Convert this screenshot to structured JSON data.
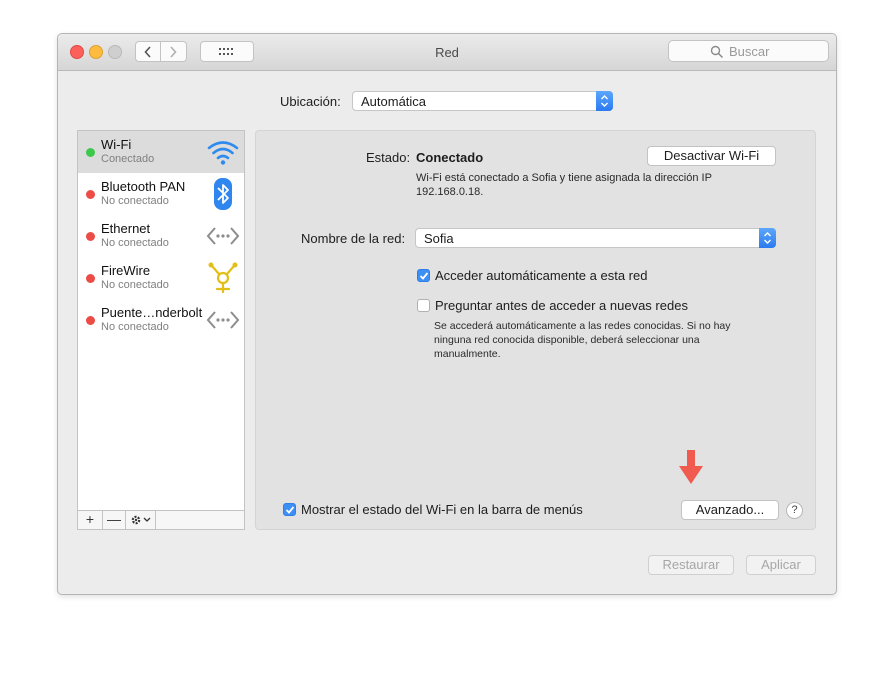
{
  "window": {
    "title": "Red",
    "search_placeholder": "Buscar"
  },
  "location": {
    "label": "Ubicación:",
    "value": "Automática"
  },
  "services": [
    {
      "name": "Wi-Fi",
      "status": "Conectado",
      "state": "green",
      "icon": "wifi-icon",
      "selected": true
    },
    {
      "name": "Bluetooth PAN",
      "status": "No conectado",
      "state": "red",
      "icon": "bluetooth-icon"
    },
    {
      "name": "Ethernet",
      "status": "No conectado",
      "state": "red",
      "icon": "ethernet-icon"
    },
    {
      "name": "FireWire",
      "status": "No conectado",
      "state": "red",
      "icon": "firewire-icon"
    },
    {
      "name": "Puente…nderbolt",
      "status": "No conectado",
      "state": "red",
      "icon": "thunderbolt-bridge-icon"
    }
  ],
  "sidebar_controls": {
    "add": "+",
    "remove": "—"
  },
  "detail": {
    "status_label": "Estado:",
    "status_value": "Conectado",
    "toggle_button": "Desactivar Wi-Fi",
    "status_description": "Wi-Fi está conectado a Sofia y tiene asignada la dirección IP 192.168.0.18.",
    "network_label": "Nombre de la red:",
    "network_value": "Sofia",
    "auto_join_label": "Acceder automáticamente a esta red",
    "auto_join_checked": true,
    "ask_join_label": "Preguntar antes de acceder a nuevas redes",
    "ask_join_checked": false,
    "ask_join_help": "Se accederá automáticamente a las redes conocidas. Si no hay ninguna red conocida disponible, deberá seleccionar una manualmente.",
    "show_status_label": "Mostrar el estado del Wi-Fi en la barra de menús",
    "show_status_checked": true,
    "advanced_button": "Avanzado...",
    "help_button": "?"
  },
  "footer": {
    "revert_button": "Restaurar",
    "apply_button": "Aplicar"
  },
  "colors": {
    "accent": "#3b8ff5",
    "connected": "#3cc84a",
    "disconnected": "#ec4b46",
    "arrow": "#f05a4f"
  }
}
